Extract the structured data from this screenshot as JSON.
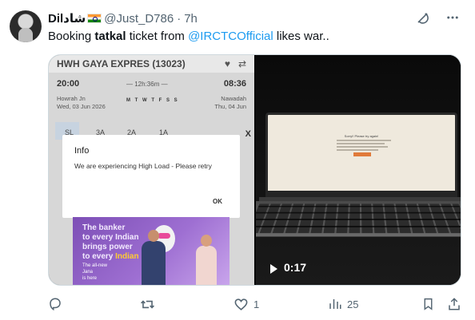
{
  "author": {
    "display_name": "Dilشاد",
    "handle": "@Just_D786",
    "separator": "·",
    "time": "7h"
  },
  "tweet": {
    "text_1": "Booking ",
    "text_bold": "tatkal",
    "text_2": " ticket from ",
    "mention": "@IRCTCOfficial",
    "text_3": " likes war.."
  },
  "media": {
    "screenshot": {
      "train_title": "HWH GAYA EXPRES (13023)",
      "depart_time": "20:00",
      "duration": "— 12h:36m —",
      "arrive_time": "08:36",
      "from_station": "Howrah Jn",
      "from_date": "Wed, 03 Jun  2026",
      "to_station": "Nawadah",
      "to_date": "Thu, 04 Jun",
      "days": "M T W T F S S",
      "classes": [
        "SL",
        "3A",
        "2A",
        "1A"
      ],
      "close_label": "X",
      "dialog": {
        "title": "Info",
        "message": "We are experiencing High Load - Please retry",
        "ok_label": "OK"
      },
      "ad": {
        "line1": "The banker",
        "line2": "to every Indian",
        "line3": "brings power",
        "line4": "to every ",
        "line4_highlight": "Indian",
        "small1": "The all-new",
        "small2": "Jana",
        "small3": "is here"
      }
    },
    "video": {
      "screen_title": "Sorry!! Please try again!",
      "duration": "0:17"
    }
  },
  "actions": {
    "reply_count": "",
    "retweet_count": "",
    "like_count": "1",
    "views_count": "25"
  },
  "icons": {
    "grok": "grok-icon",
    "more": "more-icon",
    "reply": "reply-icon",
    "retweet": "retweet-icon",
    "like": "heart-icon",
    "views": "views-icon",
    "bookmark": "bookmark-icon",
    "share": "share-icon"
  },
  "colors": {
    "link": "#1d9bf0",
    "muted": "#536471",
    "text": "#0f1419"
  }
}
